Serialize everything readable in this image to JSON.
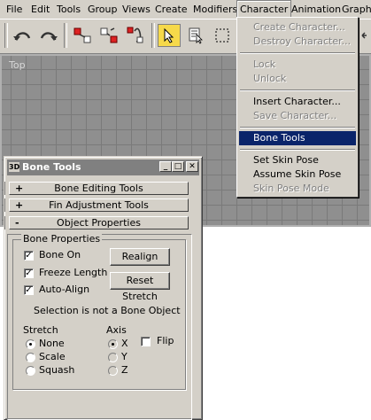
{
  "menubar": {
    "items": [
      "File",
      "Edit",
      "Tools",
      "Group",
      "Views",
      "Create",
      "Modifiers",
      "Character",
      "Animation",
      "Graph E"
    ]
  },
  "viewport": {
    "label": "Top"
  },
  "character_menu": {
    "items": [
      {
        "label": "Create Character...",
        "enabled": false
      },
      {
        "label": "Destroy Character...",
        "enabled": false
      },
      {
        "label": "Lock",
        "enabled": false
      },
      {
        "label": "Unlock",
        "enabled": false
      },
      {
        "label": "Insert Character...",
        "enabled": true
      },
      {
        "label": "Save Character...",
        "enabled": false
      },
      {
        "label": "Bone Tools",
        "enabled": true,
        "selected": true
      },
      {
        "label": "Set Skin Pose",
        "enabled": true
      },
      {
        "label": "Assume Skin Pose",
        "enabled": true
      },
      {
        "label": "Skin Pose Mode",
        "enabled": false
      }
    ]
  },
  "bone_tools": {
    "title": "Bone Tools",
    "title_icon": "3D",
    "rollouts": [
      {
        "sign": "+",
        "label": "Bone Editing Tools"
      },
      {
        "sign": "+",
        "label": "Fin Adjustment Tools"
      },
      {
        "sign": "-",
        "label": "Object Properties"
      }
    ],
    "bone_properties": {
      "legend": "Bone Properties",
      "bone_on": {
        "label": "Bone On",
        "checked": true
      },
      "freeze_length": {
        "label": "Freeze Length",
        "checked": true
      },
      "auto_align": {
        "label": "Auto-Align",
        "checked": true
      },
      "realign_label": "Realign",
      "reset_stretch_label": "Reset Stretch",
      "status": "Selection is not a Bone Object",
      "stretch": {
        "label": "Stretch",
        "options": [
          "None",
          "Scale",
          "Squash"
        ],
        "selected": "None"
      },
      "axis": {
        "label": "Axis",
        "options": [
          "X",
          "Y",
          "Z"
        ],
        "selected": "X"
      },
      "flip": {
        "label": "Flip",
        "checked": false
      }
    }
  }
}
